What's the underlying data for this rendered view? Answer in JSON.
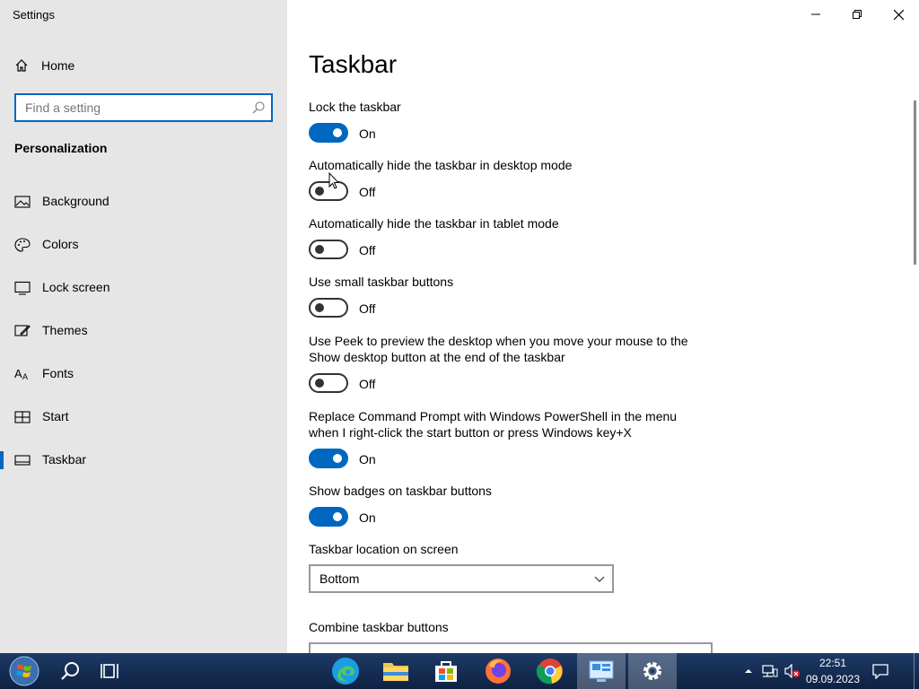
{
  "window": {
    "title": "Settings"
  },
  "sidebar": {
    "home_label": "Home",
    "search_placeholder": "Find a setting",
    "section_title": "Personalization",
    "items": [
      {
        "label": "Background",
        "icon": "picture-icon"
      },
      {
        "label": "Colors",
        "icon": "palette-icon"
      },
      {
        "label": "Lock screen",
        "icon": "lock-screen-icon"
      },
      {
        "label": "Themes",
        "icon": "themes-icon"
      },
      {
        "label": "Fonts",
        "icon": "fonts-icon"
      },
      {
        "label": "Start",
        "icon": "start-icon"
      },
      {
        "label": "Taskbar",
        "icon": "taskbar-icon",
        "active": true
      }
    ]
  },
  "main": {
    "title": "Taskbar",
    "settings": [
      {
        "label": "Lock the taskbar",
        "state": "On"
      },
      {
        "label": "Automatically hide the taskbar in desktop mode",
        "state": "Off"
      },
      {
        "label": "Automatically hide the taskbar in tablet mode",
        "state": "Off"
      },
      {
        "label": "Use small taskbar buttons",
        "state": "Off"
      },
      {
        "label": "Use Peek to preview the desktop when you move your mouse to the Show desktop button at the end of the taskbar",
        "state": "Off"
      },
      {
        "label": "Replace Command Prompt with Windows PowerShell in the menu when I right-click the start button or press Windows key+X",
        "state": "On"
      },
      {
        "label": "Show badges on taskbar buttons",
        "state": "On"
      }
    ],
    "location_label": "Taskbar location on screen",
    "location_value": "Bottom",
    "combine_label": "Combine taskbar buttons"
  },
  "taskbar": {
    "apps": [
      "start-icon",
      "search-icon",
      "task-view-icon",
      "edge-icon",
      "file-explorer-icon",
      "store-icon",
      "firefox-icon",
      "chrome-icon",
      "control-panel-icon",
      "settings-icon"
    ],
    "time": "22:51",
    "date": "09.09.2023"
  },
  "colors": {
    "accent": "#0067c0",
    "sidebar_bg": "#e6e6e6",
    "taskbar_bg": "#13294b"
  }
}
